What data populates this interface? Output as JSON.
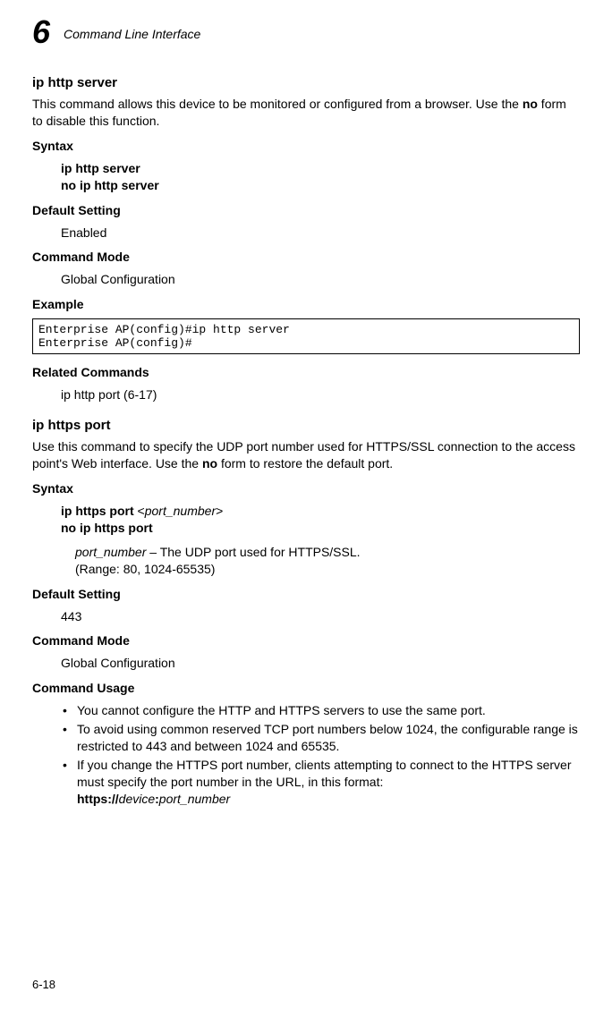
{
  "header": {
    "chapter_num": "6",
    "title": "Command Line Interface"
  },
  "s1": {
    "heading": "ip http server",
    "desc_pre": "This command allows this device to be monitored or configured from a browser. Use the ",
    "desc_bold": "no",
    "desc_post": " form to disable this function.",
    "syntax_label": "Syntax",
    "syntax1": "ip http server",
    "syntax2": "no ip http server",
    "default_label": "Default Setting",
    "default_val": "Enabled",
    "mode_label": "Command Mode",
    "mode_val": "Global Configuration",
    "example_label": "Example",
    "example_text": "Enterprise AP(config)#ip http server\nEnterprise AP(config)#",
    "related_label": "Related Commands",
    "related_val": "ip http port (6-17)"
  },
  "s2": {
    "heading": "ip https port",
    "desc_pre": "Use this command to specify the UDP port number used for HTTPS/SSL connection to the access point's Web interface. Use the ",
    "desc_bold": "no",
    "desc_post": " form to restore the default port.",
    "syntax_label": "Syntax",
    "syntax1_bold": "ip https port ",
    "syntax1_angle_open": "<",
    "syntax1_param": "port_number",
    "syntax1_angle_close": ">",
    "syntax2": "no ip https port",
    "param_name": "port_number",
    "param_desc": " – The UDP port used for HTTPS/SSL.",
    "param_range": "(Range: 80, 1024-65535)",
    "default_label": "Default Setting",
    "default_val": "443",
    "mode_label": "Command Mode",
    "mode_val": "Global Configuration",
    "usage_label": "Command Usage",
    "bullet1": "You cannot configure the HTTP and HTTPS servers to use the same port.",
    "bullet2": "To avoid using common reserved TCP port numbers below 1024, the configurable range is restricted to 443 and between 1024 and 65535.",
    "bullet3_pre": "If you change the HTTPS port number, clients attempting to connect to the HTTPS server must specify the port number in the URL, in this format: ",
    "bullet3_b1": "https://",
    "bullet3_i1": "device",
    "bullet3_b2": ":",
    "bullet3_i2": "port_number"
  },
  "page_number": "6-18"
}
